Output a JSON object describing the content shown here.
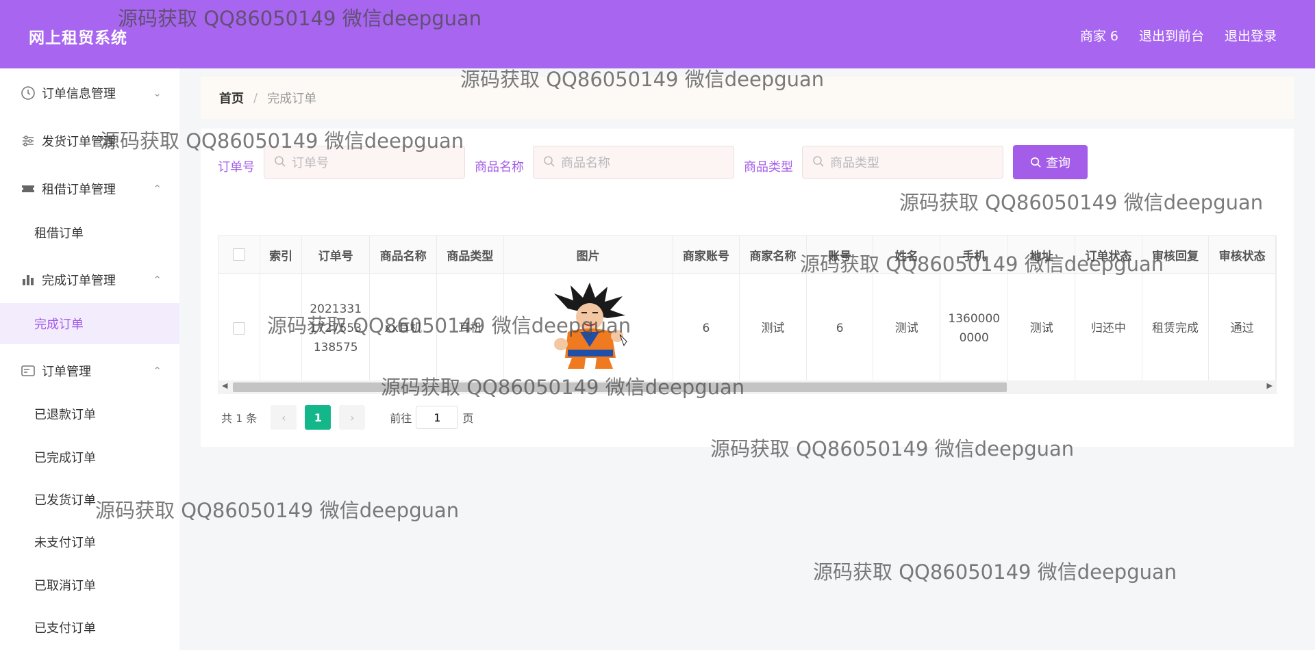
{
  "header": {
    "app_title": "网上租贸系统",
    "links": [
      "商家 6",
      "退出到前台",
      "退出登录"
    ],
    "background_color": "#a866f0"
  },
  "sidebar": {
    "groups": [
      {
        "label": "订单信息管理",
        "icon": "clock-icon",
        "expanded": false
      },
      {
        "label": "发货订单管理",
        "icon": "sliders-icon",
        "expanded": false
      },
      {
        "label": "租借订单管理",
        "icon": "ticket-icon",
        "expanded": true,
        "items": [
          "租借订单"
        ]
      },
      {
        "label": "完成订单管理",
        "icon": "bar-chart-icon",
        "expanded": true,
        "items": [
          "完成订单"
        ]
      },
      {
        "label": "订单管理",
        "icon": "card-icon",
        "expanded": true,
        "items": [
          "已退款订单",
          "已完成订单",
          "已发货订单",
          "未支付订单",
          "已取消订单",
          "已支付订单"
        ]
      }
    ],
    "active_item": "完成订单"
  },
  "breadcrumb": {
    "home": "首页",
    "separator": "/",
    "current": "完成订单"
  },
  "search": {
    "fields": [
      {
        "label": "订单号",
        "placeholder": "订单号",
        "value": ""
      },
      {
        "label": "商品名称",
        "placeholder": "商品名称",
        "value": ""
      },
      {
        "label": "商品类型",
        "placeholder": "商品类型",
        "value": ""
      }
    ],
    "button_label": "查询"
  },
  "table": {
    "headers": [
      "索引",
      "订单号",
      "商品名称",
      "商品类型",
      "图片",
      "商家账号",
      "商家名称",
      "账号",
      "姓名",
      "手机",
      "地址",
      "订单状态",
      "审核回复",
      "审核状态"
    ],
    "rows": [
      {
        "index": "",
        "order_no": "20213311727553138575",
        "product_name": "xx耳机",
        "product_type": "耳机",
        "image": "goku-image",
        "merchant_account": "6",
        "merchant_name": "测试",
        "account": "6",
        "name": "测试",
        "phone": "13600000000",
        "address": "测试",
        "order_status": "归还中",
        "review_reply": "租赁完成",
        "review_status": "通过"
      }
    ]
  },
  "pagination": {
    "total": "共 1 条",
    "current_page": "1",
    "goto_label": "前往",
    "goto_value": "1",
    "page_suffix": "页"
  },
  "watermark": "源码获取 QQ86050149 微信deepguan",
  "colors": {
    "accent": "#a45de8",
    "page_active": "#14b789"
  }
}
